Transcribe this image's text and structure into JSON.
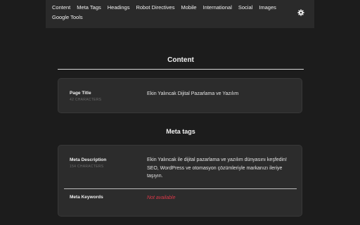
{
  "nav": {
    "items": [
      "Content",
      "Meta Tags",
      "Headings",
      "Robot Directives",
      "Mobile",
      "International",
      "Social",
      "Images",
      "Google Tools"
    ],
    "settings_icon": "gear-icon"
  },
  "content_section": {
    "title": "Content",
    "page_title": {
      "label": "Page Title",
      "count": "42 CHARACTERS",
      "value": "Ekin Yalıncak Dijital Pazarlama ve Yazılım"
    }
  },
  "meta_section": {
    "title": "Meta tags",
    "description": {
      "label": "Meta Description",
      "count": "154 CHARACTERS",
      "value": "Ekin Yalıncak ile dijital pazarlama ve yazılım dünyasını keşfedin! SEO, WordPress ve otomasyon çözümleriyle markanızı ileriye taşıyın."
    },
    "keywords": {
      "label": "Meta Keywords",
      "value": "Not available"
    }
  },
  "colors": {
    "background": "#1c1c1c",
    "card": "#2c2c2c",
    "not_available": "#d93848"
  }
}
